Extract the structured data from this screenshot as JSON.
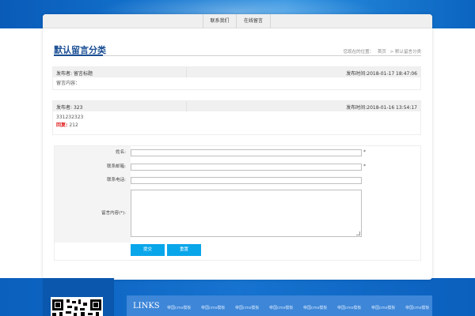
{
  "topnav": {
    "tab1": "联系我们",
    "tab2": "在线留言"
  },
  "page": {
    "title": "默认留言分类"
  },
  "breadcrumb": {
    "prefix": "您现在的位置：",
    "home": "首页",
    "current": "> 默认留言分类"
  },
  "messages": [
    {
      "author_label": "发布者:",
      "author": "留言标题",
      "time_label": "发布时间:",
      "time": "2018-01-17 18:47:06",
      "content": "留言内容：",
      "reply_label": "",
      "reply": ""
    },
    {
      "author_label": "发布者:",
      "author": "323",
      "time_label": "发布时间:",
      "time": "2018-01-16 13:54:17",
      "content": "331232323",
      "reply_label": "回复:",
      "reply": "212"
    }
  ],
  "form": {
    "name_label": "姓名:",
    "email_label": "联系邮箱:",
    "phone_label": "联系电话:",
    "content_label": "留言内容(*):",
    "required_mark": "*",
    "submit_label": "提交",
    "reset_label": "重置"
  },
  "footer": {
    "links_title": "LINKS",
    "links": [
      "帝国cms模板",
      "帝国cms模板",
      "帝国cms模板",
      "帝国cms模板",
      "帝国cms模板",
      "帝国cms模板",
      "帝国cms模板",
      "帝国cms模板"
    ]
  },
  "colors": {
    "accent": "#1a4e93",
    "button": "#0aa6ea",
    "band": "#1673cf",
    "required": "#e02020"
  }
}
